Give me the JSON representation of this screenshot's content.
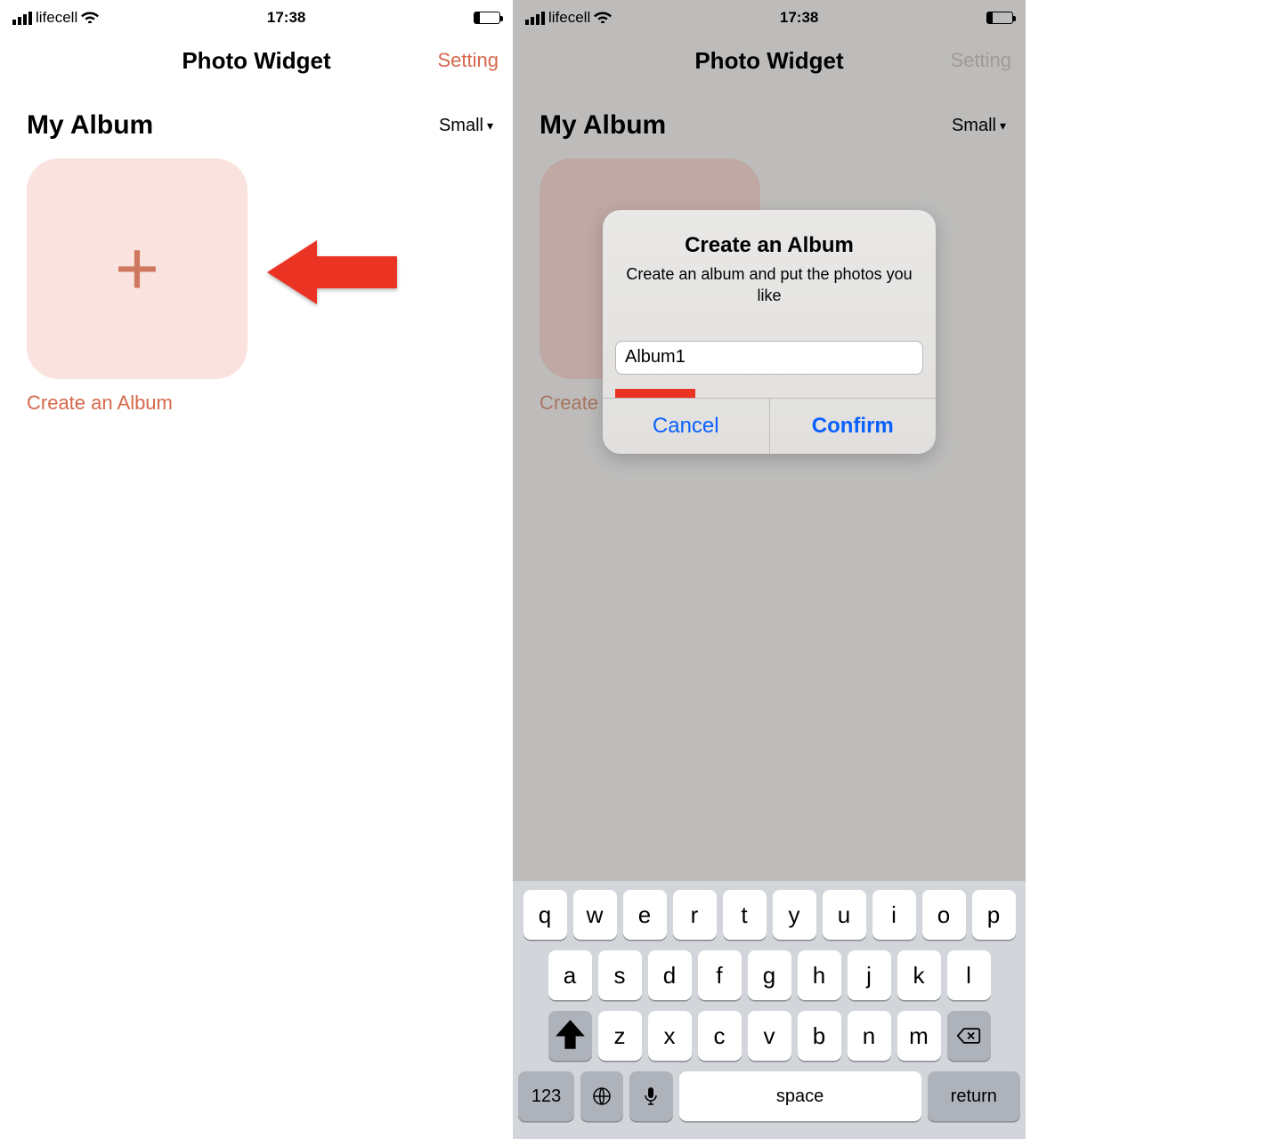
{
  "status": {
    "carrier": "lifecell",
    "time": "17:38"
  },
  "nav": {
    "title": "Photo Widget",
    "setting": "Setting"
  },
  "section": {
    "heading": "My Album",
    "sizeLabel": "Small"
  },
  "tile": {
    "label": "Create an Album"
  },
  "dialog": {
    "title": "Create an Album",
    "message": "Create an album and put the photos you like",
    "inputValue": "Album1",
    "cancel": "Cancel",
    "confirm": "Confirm"
  },
  "keyboard": {
    "row1": [
      "q",
      "w",
      "e",
      "r",
      "t",
      "y",
      "u",
      "i",
      "o",
      "p"
    ],
    "row2": [
      "a",
      "s",
      "d",
      "f",
      "g",
      "h",
      "j",
      "k",
      "l"
    ],
    "row3": [
      "z",
      "x",
      "c",
      "v",
      "b",
      "n",
      "m"
    ],
    "numKey": "123",
    "space": "space",
    "return": "return"
  }
}
